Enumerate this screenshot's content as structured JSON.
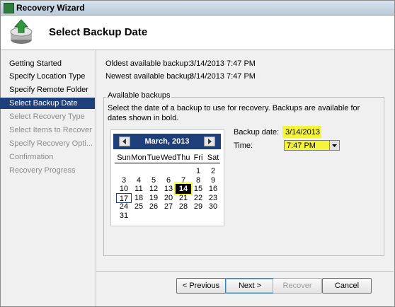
{
  "window": {
    "title": "Recovery Wizard"
  },
  "header": {
    "title": "Select Backup Date",
    "icon": "recovery-wizard-icon"
  },
  "steps": [
    {
      "label": "Getting Started",
      "state": "done"
    },
    {
      "label": "Specify Location Type",
      "state": "done"
    },
    {
      "label": "Specify Remote Folder",
      "state": "done"
    },
    {
      "label": "Select Backup Date",
      "state": "active"
    },
    {
      "label": "Select Recovery Type",
      "state": "disabled"
    },
    {
      "label": "Select Items to Recover",
      "state": "disabled"
    },
    {
      "label": "Specify Recovery Opti...",
      "state": "disabled"
    },
    {
      "label": "Confirmation",
      "state": "disabled"
    },
    {
      "label": "Recovery Progress",
      "state": "disabled"
    }
  ],
  "summary": {
    "oldest_label": "Oldest available backup:",
    "oldest_value": "3/14/2013 7:47 PM",
    "newest_label": "Newest available backup:",
    "newest_value": "3/14/2013 7:47 PM"
  },
  "available": {
    "group_label": "Available backups",
    "description": "Select the date of a backup to use for recovery. Backups are available for dates shown in bold."
  },
  "calendar": {
    "month_label": "March, 2013",
    "days_of_week": [
      "Sun",
      "Mon",
      "Tue",
      "Wed",
      "Thu",
      "Fri",
      "Sat"
    ],
    "weeks": [
      [
        "",
        "",
        "",
        "",
        "",
        "1",
        "2"
      ],
      [
        "3",
        "4",
        "5",
        "6",
        "7",
        "8",
        "9"
      ],
      [
        "10",
        "11",
        "12",
        "13",
        "14",
        "15",
        "16"
      ],
      [
        "17",
        "18",
        "19",
        "20",
        "21",
        "22",
        "23"
      ],
      [
        "24",
        "25",
        "26",
        "27",
        "28",
        "29",
        "30"
      ],
      [
        "31",
        "",
        "",
        "",
        "",
        "",
        ""
      ]
    ],
    "selected_day": "14",
    "today_day": "17"
  },
  "backup": {
    "date_label": "Backup date:",
    "date_value": "3/14/2013",
    "time_label": "Time:",
    "time_value": "7:47 PM"
  },
  "buttons": {
    "previous": "< Previous",
    "next": "Next >",
    "recover": "Recover",
    "cancel": "Cancel"
  },
  "colors": {
    "selection": "#1f3f7a",
    "highlight": "#f4f43a",
    "disabled_text": "#8c8c8c"
  }
}
